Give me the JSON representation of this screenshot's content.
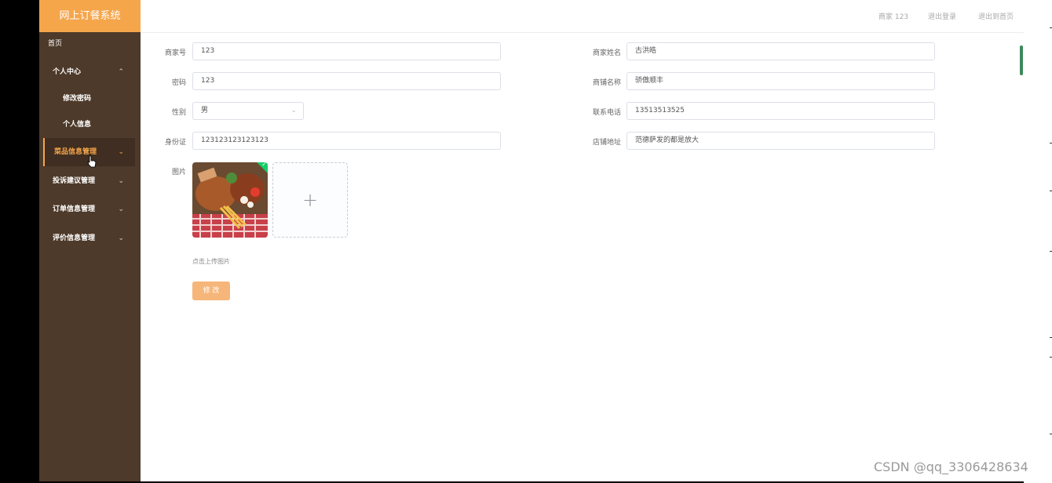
{
  "app": {
    "title": "网上订餐系统"
  },
  "sidebar": {
    "home": "首页",
    "items": [
      {
        "label": "个人中心",
        "chevron": "⌃"
      },
      {
        "label": "修改密码"
      },
      {
        "label": "个人信息"
      },
      {
        "label": "菜品信息管理",
        "chevron": "⌄"
      },
      {
        "label": "投诉建议管理",
        "chevron": "⌄"
      },
      {
        "label": "订单信息管理",
        "chevron": "⌄"
      },
      {
        "label": "评价信息管理",
        "chevron": "⌄"
      }
    ]
  },
  "header": {
    "user": "商家 123",
    "logout": "退出登录",
    "back_home": "退出到首页"
  },
  "form": {
    "merchant_no": {
      "label": "商家号",
      "value": "123"
    },
    "merchant_name": {
      "label": "商家姓名",
      "value": "古洪皓"
    },
    "password": {
      "label": "密码",
      "value": "123"
    },
    "shop_name": {
      "label": "商铺名称",
      "value": "骄傲顺丰"
    },
    "gender": {
      "label": "性别",
      "value": "男"
    },
    "phone": {
      "label": "联系电话",
      "value": "13513513525"
    },
    "id_card": {
      "label": "身份证",
      "value": "123123123123123"
    },
    "address": {
      "label": "店铺地址",
      "value": "范德萨发的都是放大"
    },
    "image": {
      "label": "图片",
      "hint": "点击上传图片",
      "plus": "+"
    },
    "submit_label": "修 改"
  },
  "watermark": "CSDN @qq_3306428634",
  "colors": {
    "sidebar": "#4e3a2a",
    "accent": "#f5a64b",
    "button": "#f6b67a"
  }
}
